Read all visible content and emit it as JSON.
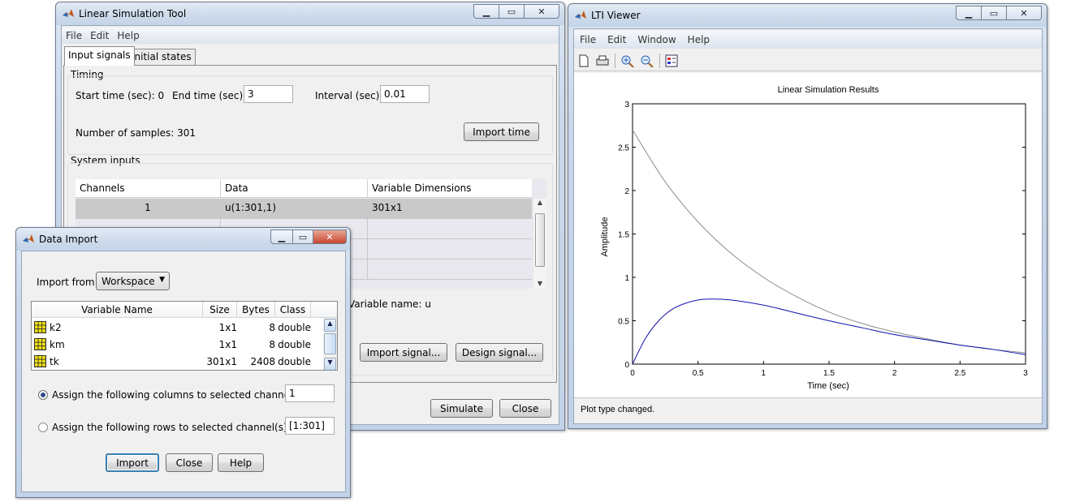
{
  "lst": {
    "title": "Linear Simulation Tool",
    "menu": [
      "File",
      "Edit",
      "Help"
    ],
    "tabs": [
      "Input signals",
      "Initial states"
    ],
    "timing": {
      "legend": "Timing",
      "start_label": "Start time (sec): 0",
      "end_label": "End time (sec):",
      "end_value": "3",
      "interval_label": "Interval (sec):",
      "interval_value": "0.01",
      "samples_label": "Number of samples: 301",
      "import_time": "Import time"
    },
    "system_inputs": {
      "legend": "System inputs",
      "columns": [
        "Channels",
        "Data",
        "Variable Dimensions"
      ],
      "rows": [
        [
          "1",
          "u(1:301,1)",
          "301x1"
        ]
      ],
      "variable_name": "Variable name: u",
      "import_signal": "Import signal...",
      "design_signal": "Design signal..."
    },
    "simulate": "Simulate",
    "close": "Close"
  },
  "lti": {
    "title": "LTI Viewer",
    "menu": [
      "File",
      "Edit",
      "Window",
      "Help"
    ],
    "toolbar_icons": [
      "new-icon",
      "print-icon",
      "zoom-in-icon",
      "zoom-out-icon",
      "plot-config-icon"
    ],
    "status": "Plot type changed."
  },
  "chart_data": {
    "type": "line",
    "title": "Linear Simulation Results",
    "xlabel": "Time (sec)",
    "ylabel": "Amplitude",
    "xlim": [
      0,
      3
    ],
    "ylim": [
      0,
      3
    ],
    "xticks": [
      "0",
      "0.5",
      "1",
      "1.5",
      "2",
      "2.5",
      "3"
    ],
    "yticks": [
      "0",
      "0.5",
      "1",
      "1.5",
      "2",
      "2.5",
      "3"
    ],
    "grid": false,
    "series": [
      {
        "color": "#8c8c8c",
        "x": [
          0,
          0.25,
          0.5,
          0.75,
          1,
          1.25,
          1.5,
          1.75,
          2,
          2.25,
          2.5,
          2.75,
          3
        ],
        "y": [
          2.7,
          2.1,
          1.64,
          1.28,
          1.0,
          0.78,
          0.6,
          0.47,
          0.37,
          0.29,
          0.22,
          0.17,
          0.13
        ]
      },
      {
        "color": "#1010b0",
        "x": [
          0,
          0.1,
          0.2,
          0.3,
          0.4,
          0.5,
          0.6,
          0.75,
          1,
          1.25,
          1.5,
          1.75,
          2,
          2.25,
          2.5,
          2.75,
          3
        ],
        "y": [
          0,
          0.3,
          0.5,
          0.63,
          0.7,
          0.74,
          0.75,
          0.74,
          0.68,
          0.59,
          0.5,
          0.42,
          0.34,
          0.28,
          0.22,
          0.17,
          0.11
        ]
      }
    ]
  },
  "data_import": {
    "title": "Data Import",
    "import_from_label": "Import from:",
    "import_from_value": "Workspace",
    "columns": [
      "Variable Name",
      "Size",
      "Bytes",
      "Class"
    ],
    "rows": [
      {
        "name": "k2",
        "size": "1x1",
        "bytes": "8",
        "class": "double"
      },
      {
        "name": "km",
        "size": "1x1",
        "bytes": "8",
        "class": "double"
      },
      {
        "name": "tk",
        "size": "301x1",
        "bytes": "2408",
        "class": "double"
      }
    ],
    "assign_columns_label": "Assign the following columns to selected channel(s):",
    "assign_columns_value": "1",
    "assign_rows_label": "Assign the following rows to selected channel(s):",
    "assign_rows_value": "[1:301]",
    "import": "Import",
    "close": "Close",
    "help": "Help"
  }
}
